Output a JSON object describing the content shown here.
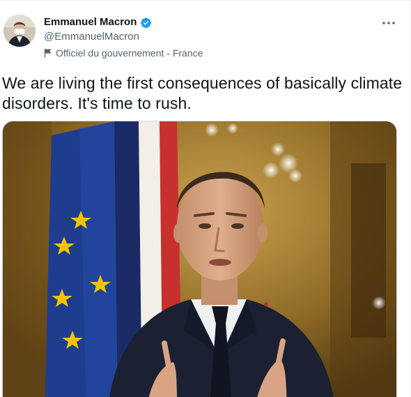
{
  "author": {
    "display_name": "Emmanuel Macron",
    "handle": "@EmmanuelMacron",
    "verified": true,
    "government_label": "Officiel du gouvernement - France"
  },
  "tweet": {
    "text": "We are living the first consequences of basically climate disorders. It's time to rush."
  },
  "icons": {
    "verified": "verified-badge-icon",
    "label": "flag-icon",
    "more": "more-icon"
  },
  "colors": {
    "verified_blue": "#1d9bf0",
    "secondary_text": "#536471"
  }
}
